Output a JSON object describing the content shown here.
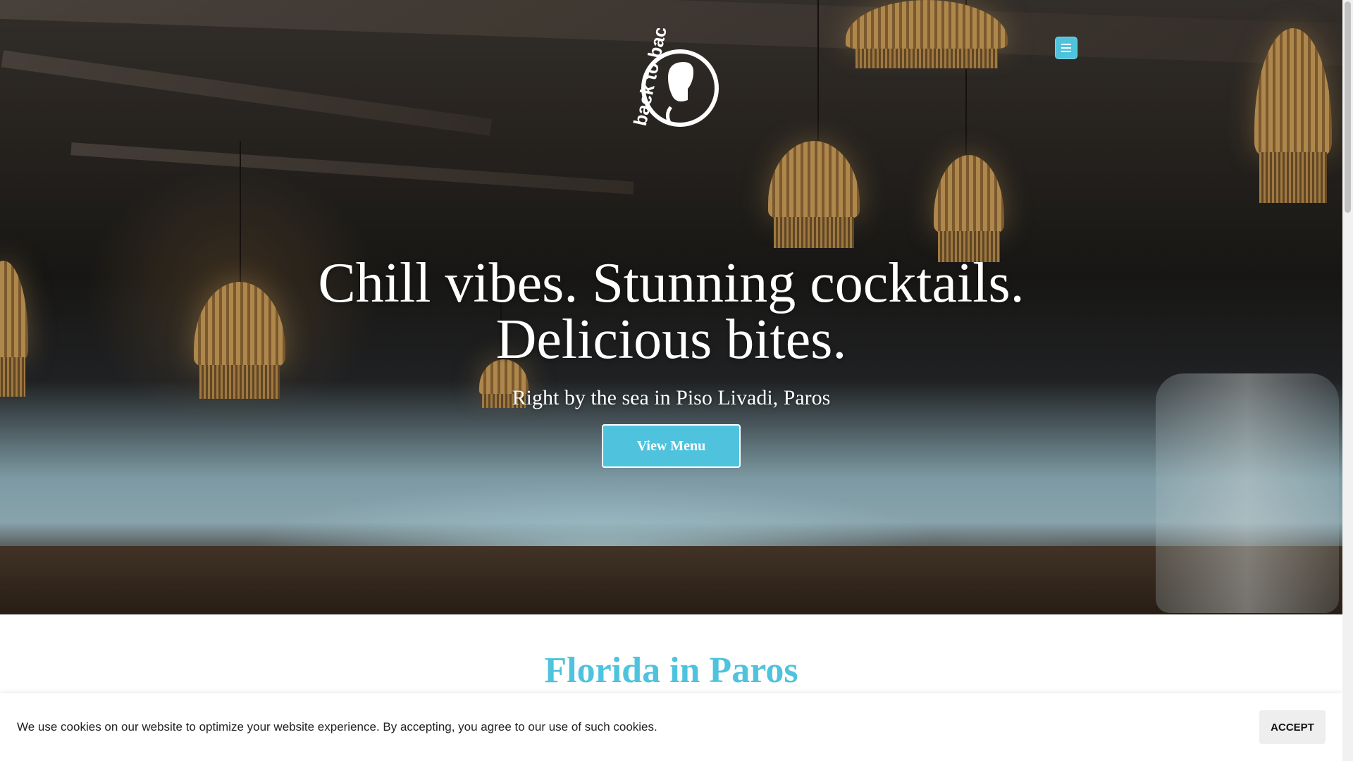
{
  "logo": {
    "alt": "back to back"
  },
  "nav": {
    "menu_icon": "hamburger-icon"
  },
  "hero": {
    "headline_line1": "Chill vibes. Stunning cocktails.",
    "headline_line2": "Delicious bites.",
    "subheadline": "Right by the sea in Piso Livadi, Paros",
    "cta_label": "View Menu"
  },
  "section": {
    "title": "Florida in Paros"
  },
  "cookie": {
    "message": "We use cookies on our website to optimize your website experience. By accepting, you agree to our use of such cookies.",
    "accept_label": "ACCEPT"
  },
  "colors": {
    "accent": "#4fc3dd",
    "text_on_hero": "#ffffff"
  }
}
